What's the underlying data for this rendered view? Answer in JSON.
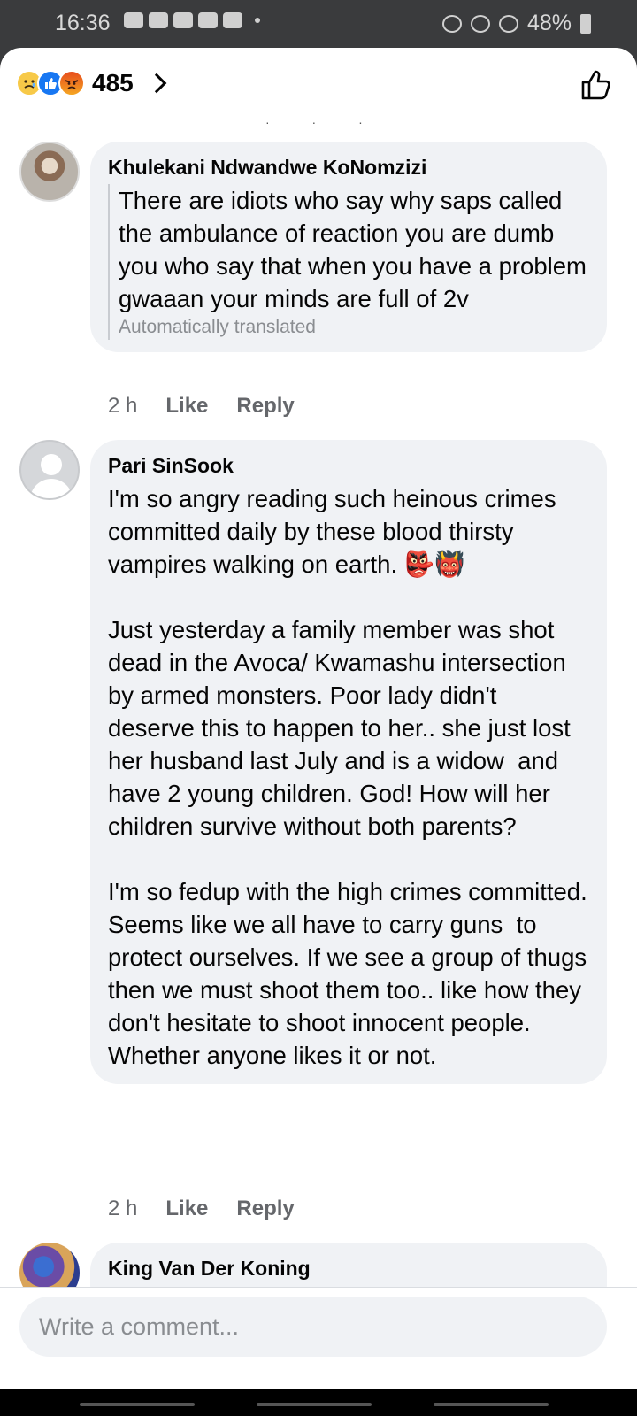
{
  "status": {
    "time": "16:36",
    "battery": "48%"
  },
  "header": {
    "reaction_count": "485"
  },
  "comments": [
    {
      "author": "Khulekani Ndwandwe KoNomzizi",
      "text": "There are idiots who say why saps called the ambulance of reaction you are dumb you who say that when you have a problem gwaaan your minds are full of 2v",
      "translated_note": "Automatically translated",
      "time": "2 h",
      "like": "Like",
      "reply": "Reply"
    },
    {
      "author": "Pari SinSook",
      "text": "I'm so angry reading such heinous crimes committed daily by these blood thirsty vampires walking on earth. 👺👹\n\nJust yesterday a family member was shot dead in the Avoca/ Kwamashu intersection by armed monsters. Poor lady didn't deserve this to happen to her.. she just lost her husband last July and is a widow  and have 2 young children. God! How will her children survive without both parents?\n\nI'm so fedup with the high crimes committed.\nSeems like we all have to carry guns  to protect ourselves. If we see a group of thugs then we must shoot them too.. like how they don't hesitate to shoot innocent people.\nWhether anyone likes it or not.",
      "time": "2 h",
      "like": "Like",
      "reply": "Reply"
    },
    {
      "author": "King Van Der Koning"
    }
  ],
  "composer": {
    "placeholder": "Write a comment..."
  }
}
